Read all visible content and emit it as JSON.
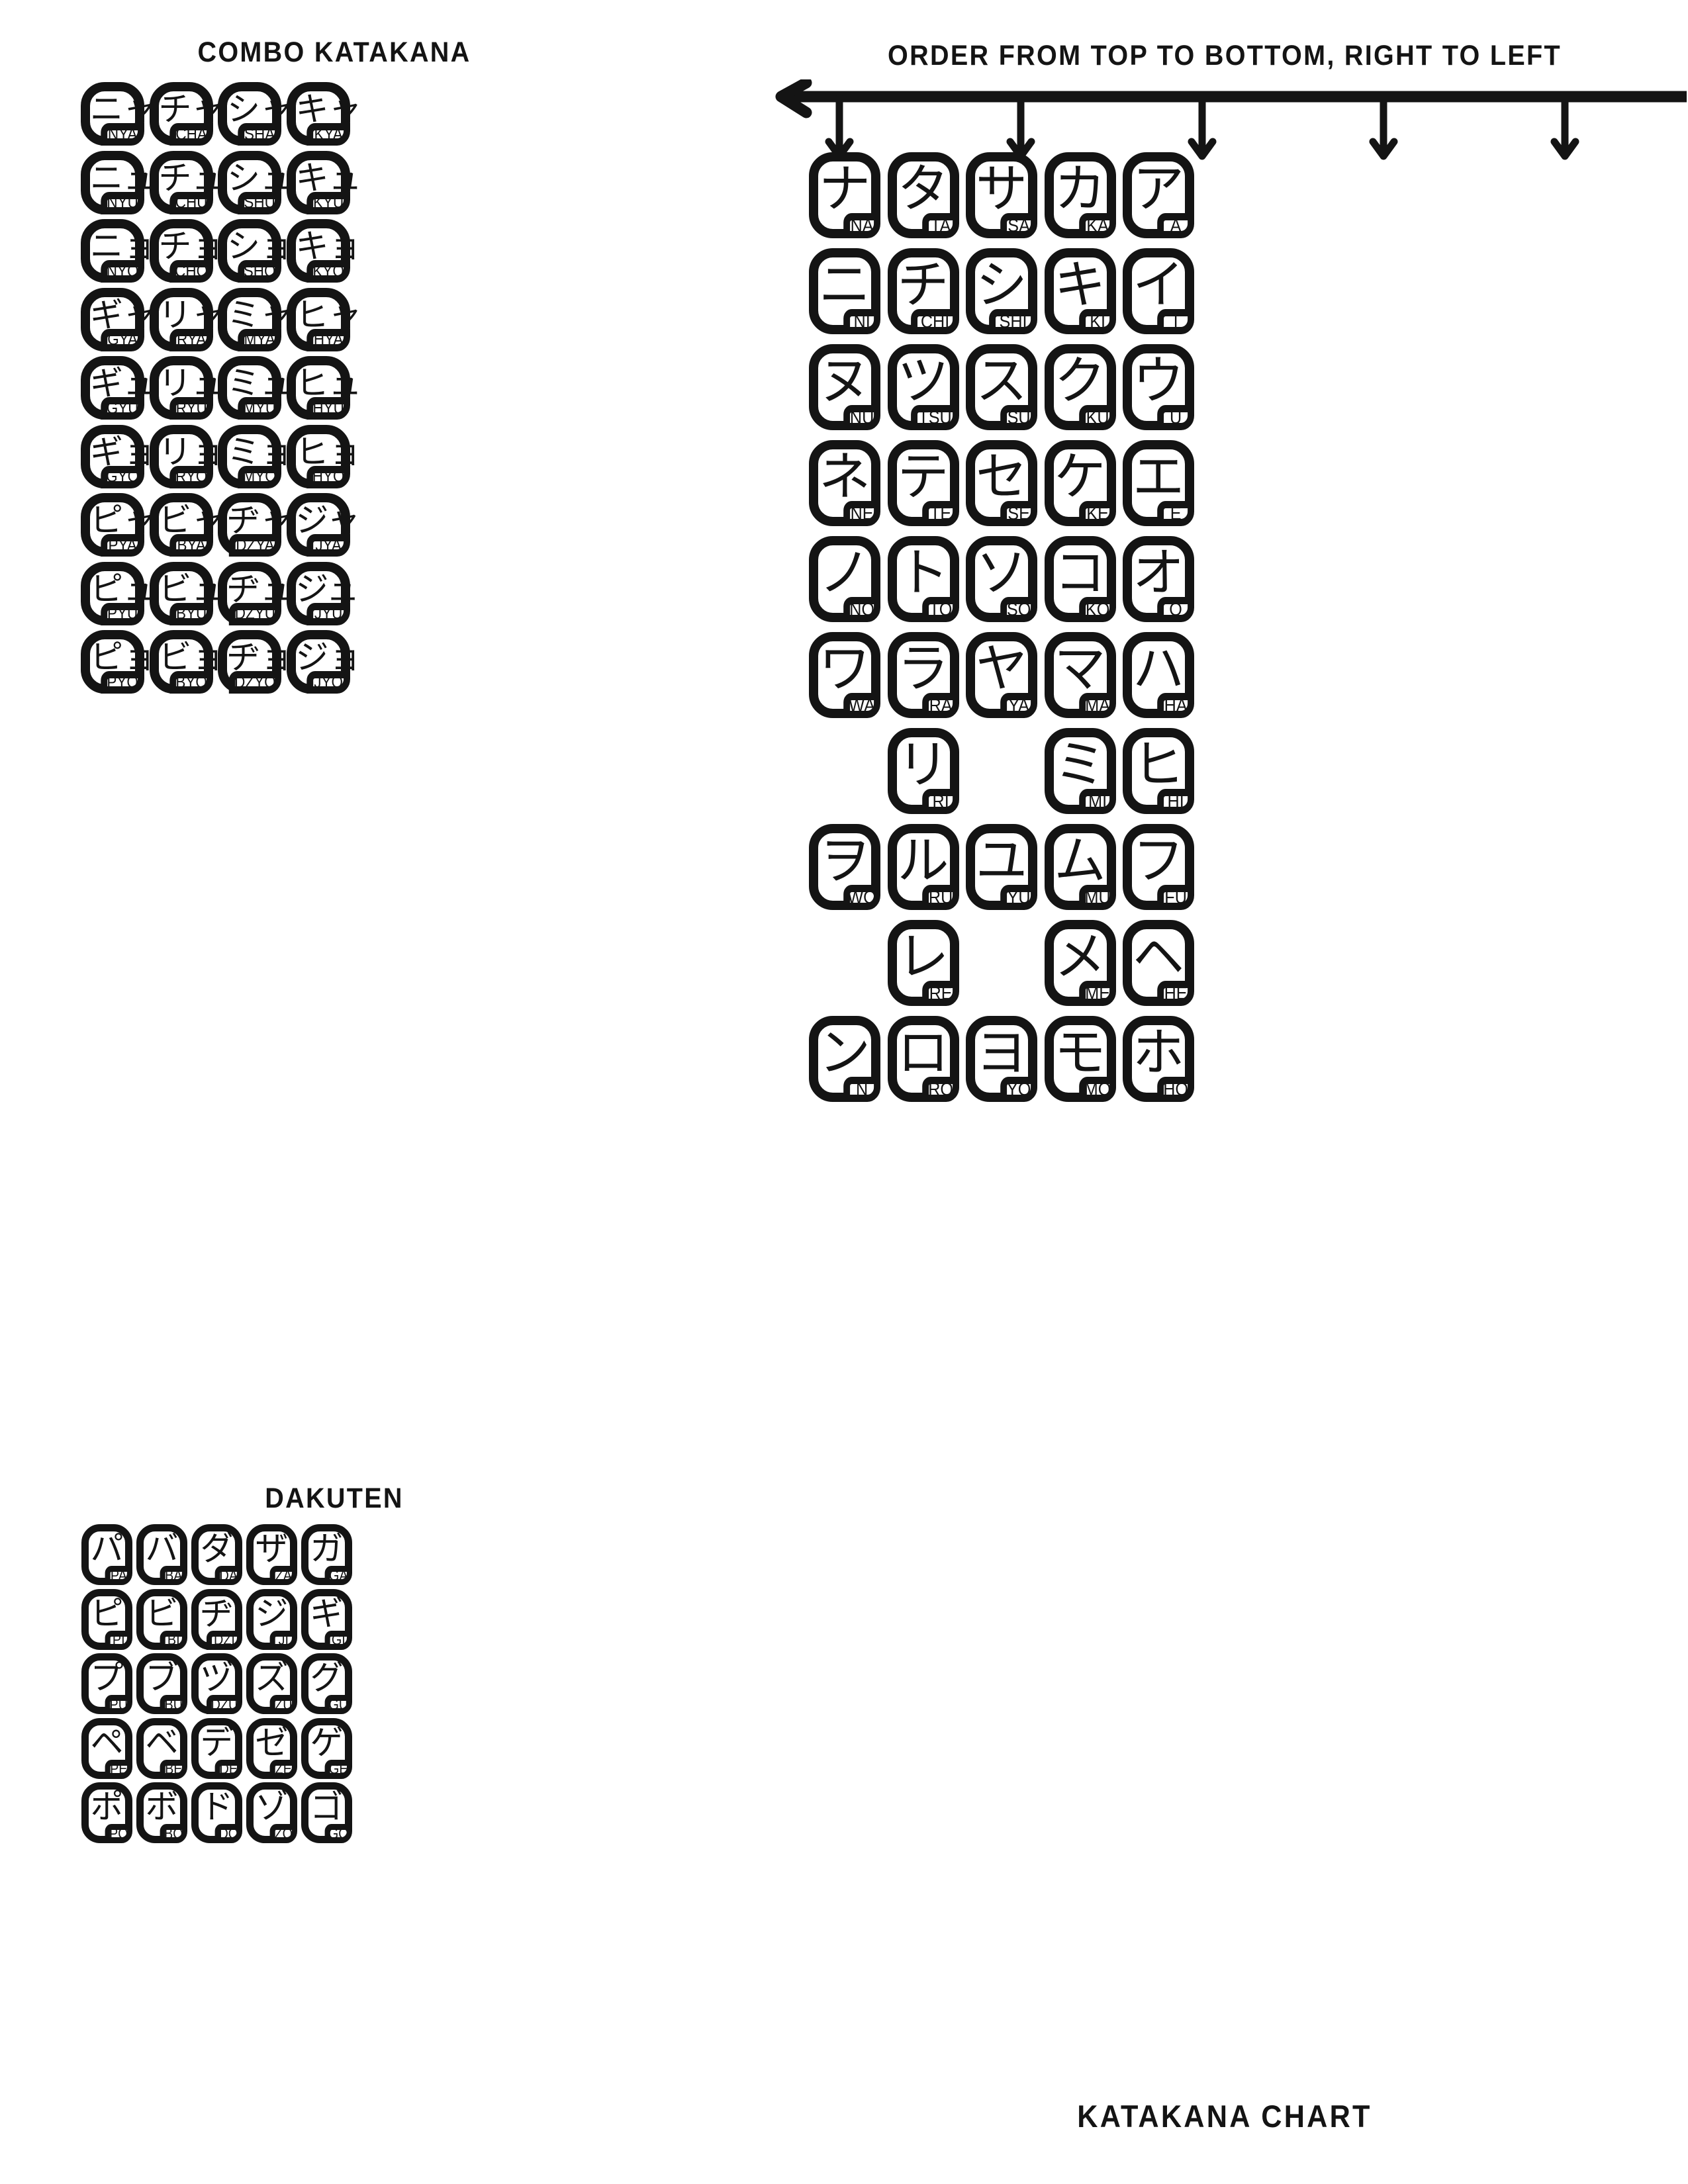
{
  "headings": {
    "combo": "COMBO KATAKANA",
    "dakuten": "DAKUTEN",
    "order": "ORDER FROM TOP TO BOTTOM, RIGHT TO LEFT",
    "chart": "KATAKANA CHART"
  },
  "colors": {
    "ink": "#141414",
    "paper": "#ffffff"
  },
  "combo_katakana": {
    "columns": 4,
    "rows": [
      [
        {
          "kana": "ニャ",
          "romaji": "NYA"
        },
        {
          "kana": "チャ",
          "romaji": "CHA"
        },
        {
          "kana": "シャ",
          "romaji": "SHA"
        },
        {
          "kana": "キャ",
          "romaji": "KYA"
        }
      ],
      [
        {
          "kana": "ニュ",
          "romaji": "NYU"
        },
        {
          "kana": "チュ",
          "romaji": "CHU"
        },
        {
          "kana": "シュ",
          "romaji": "SHU"
        },
        {
          "kana": "キュ",
          "romaji": "KYU"
        }
      ],
      [
        {
          "kana": "ニョ",
          "romaji": "NYO"
        },
        {
          "kana": "チョ",
          "romaji": "CHO"
        },
        {
          "kana": "ショ",
          "romaji": "SHO"
        },
        {
          "kana": "キョ",
          "romaji": "KYO"
        }
      ],
      [
        {
          "kana": "ギャ",
          "romaji": "GYA"
        },
        {
          "kana": "リャ",
          "romaji": "RYA"
        },
        {
          "kana": "ミャ",
          "romaji": "MYA"
        },
        {
          "kana": "ヒャ",
          "romaji": "HYA"
        }
      ],
      [
        {
          "kana": "ギュ",
          "romaji": "GYU"
        },
        {
          "kana": "リュ",
          "romaji": "RYU"
        },
        {
          "kana": "ミュ",
          "romaji": "MYU"
        },
        {
          "kana": "ヒュ",
          "romaji": "HYU"
        }
      ],
      [
        {
          "kana": "ギョ",
          "romaji": "GYO"
        },
        {
          "kana": "リョ",
          "romaji": "RYO"
        },
        {
          "kana": "ミョ",
          "romaji": "MYO"
        },
        {
          "kana": "ヒョ",
          "romaji": "HYO"
        }
      ],
      [
        {
          "kana": "ピャ",
          "romaji": "PYA"
        },
        {
          "kana": "ビャ",
          "romaji": "BYA"
        },
        {
          "kana": "ヂャ",
          "romaji": "DZYA"
        },
        {
          "kana": "ジャ",
          "romaji": "JYA"
        }
      ],
      [
        {
          "kana": "ピュ",
          "romaji": "PYU"
        },
        {
          "kana": "ビュ",
          "romaji": "BYU"
        },
        {
          "kana": "ヂュ",
          "romaji": "DZYU"
        },
        {
          "kana": "ジュ",
          "romaji": "JYU"
        }
      ],
      [
        {
          "kana": "ピョ",
          "romaji": "PYO"
        },
        {
          "kana": "ビョ",
          "romaji": "BYO"
        },
        {
          "kana": "ヂョ",
          "romaji": "DZYO"
        },
        {
          "kana": "ジョ",
          "romaji": "JYO"
        }
      ]
    ]
  },
  "dakuten": {
    "columns": 5,
    "rows": [
      [
        {
          "kana": "パ",
          "romaji": "PA"
        },
        {
          "kana": "バ",
          "romaji": "BA"
        },
        {
          "kana": "ダ",
          "romaji": "DA"
        },
        {
          "kana": "ザ",
          "romaji": "ZA"
        },
        {
          "kana": "ガ",
          "romaji": "GA"
        }
      ],
      [
        {
          "kana": "ピ",
          "romaji": "PI"
        },
        {
          "kana": "ビ",
          "romaji": "BI"
        },
        {
          "kana": "ヂ",
          "romaji": "DZI"
        },
        {
          "kana": "ジ",
          "romaji": "JI"
        },
        {
          "kana": "ギ",
          "romaji": "GI"
        }
      ],
      [
        {
          "kana": "プ",
          "romaji": "PU"
        },
        {
          "kana": "ブ",
          "romaji": "BU"
        },
        {
          "kana": "ヅ",
          "romaji": "DZU"
        },
        {
          "kana": "ズ",
          "romaji": "ZU"
        },
        {
          "kana": "グ",
          "romaji": "GU"
        }
      ],
      [
        {
          "kana": "ペ",
          "romaji": "PE"
        },
        {
          "kana": "ベ",
          "romaji": "BE"
        },
        {
          "kana": "デ",
          "romaji": "DE"
        },
        {
          "kana": "ゼ",
          "romaji": "ZE"
        },
        {
          "kana": "ゲ",
          "romaji": "GE"
        }
      ],
      [
        {
          "kana": "ポ",
          "romaji": "PO"
        },
        {
          "kana": "ボ",
          "romaji": "BO"
        },
        {
          "kana": "ド",
          "romaji": "DO"
        },
        {
          "kana": "ゾ",
          "romaji": "ZO"
        },
        {
          "kana": "ゴ",
          "romaji": "GO"
        }
      ]
    ]
  },
  "main_chart": {
    "columns": 5,
    "rows": [
      [
        {
          "kana": "ナ",
          "romaji": "NA"
        },
        {
          "kana": "タ",
          "romaji": "TA"
        },
        {
          "kana": "サ",
          "romaji": "SA"
        },
        {
          "kana": "カ",
          "romaji": "KA"
        },
        {
          "kana": "ア",
          "romaji": "A"
        }
      ],
      [
        {
          "kana": "ニ",
          "romaji": "NI"
        },
        {
          "kana": "チ",
          "romaji": "CHI"
        },
        {
          "kana": "シ",
          "romaji": "SHI"
        },
        {
          "kana": "キ",
          "romaji": "KI"
        },
        {
          "kana": "イ",
          "romaji": "I"
        }
      ],
      [
        {
          "kana": "ヌ",
          "romaji": "NU"
        },
        {
          "kana": "ツ",
          "romaji": "TSU"
        },
        {
          "kana": "ス",
          "romaji": "SU"
        },
        {
          "kana": "ク",
          "romaji": "KU"
        },
        {
          "kana": "ウ",
          "romaji": "U"
        }
      ],
      [
        {
          "kana": "ネ",
          "romaji": "NE"
        },
        {
          "kana": "テ",
          "romaji": "TE"
        },
        {
          "kana": "セ",
          "romaji": "SE"
        },
        {
          "kana": "ケ",
          "romaji": "KE"
        },
        {
          "kana": "エ",
          "romaji": "E"
        }
      ],
      [
        {
          "kana": "ノ",
          "romaji": "NO"
        },
        {
          "kana": "ト",
          "romaji": "TO"
        },
        {
          "kana": "ソ",
          "romaji": "SO"
        },
        {
          "kana": "コ",
          "romaji": "KO"
        },
        {
          "kana": "オ",
          "romaji": "O"
        }
      ],
      [
        {
          "kana": "ワ",
          "romaji": "WA"
        },
        {
          "kana": "ラ",
          "romaji": "RA"
        },
        {
          "kana": "ヤ",
          "romaji": "YA"
        },
        {
          "kana": "マ",
          "romaji": "MA"
        },
        {
          "kana": "ハ",
          "romaji": "HA"
        }
      ],
      [
        null,
        {
          "kana": "リ",
          "romaji": "RI"
        },
        null,
        {
          "kana": "ミ",
          "romaji": "MI"
        },
        {
          "kana": "ヒ",
          "romaji": "HI"
        }
      ],
      [
        {
          "kana": "ヲ",
          "romaji": "WO"
        },
        {
          "kana": "ル",
          "romaji": "RU"
        },
        {
          "kana": "ユ",
          "romaji": "YU"
        },
        {
          "kana": "ム",
          "romaji": "MU"
        },
        {
          "kana": "フ",
          "romaji": "FU"
        }
      ],
      [
        null,
        {
          "kana": "レ",
          "romaji": "RE"
        },
        null,
        {
          "kana": "メ",
          "romaji": "ME"
        },
        {
          "kana": "ヘ",
          "romaji": "HE"
        }
      ],
      [
        {
          "kana": "ン",
          "romaji": "N"
        },
        {
          "kana": "ロ",
          "romaji": "RO"
        },
        {
          "kana": "ヨ",
          "romaji": "YO"
        },
        {
          "kana": "モ",
          "romaji": "MO"
        },
        {
          "kana": "ホ",
          "romaji": "HO"
        }
      ]
    ]
  },
  "order_arrow": {
    "direction": "right-to-left",
    "column_arrows": 5,
    "icon": "arrow-left-with-down-branches"
  }
}
